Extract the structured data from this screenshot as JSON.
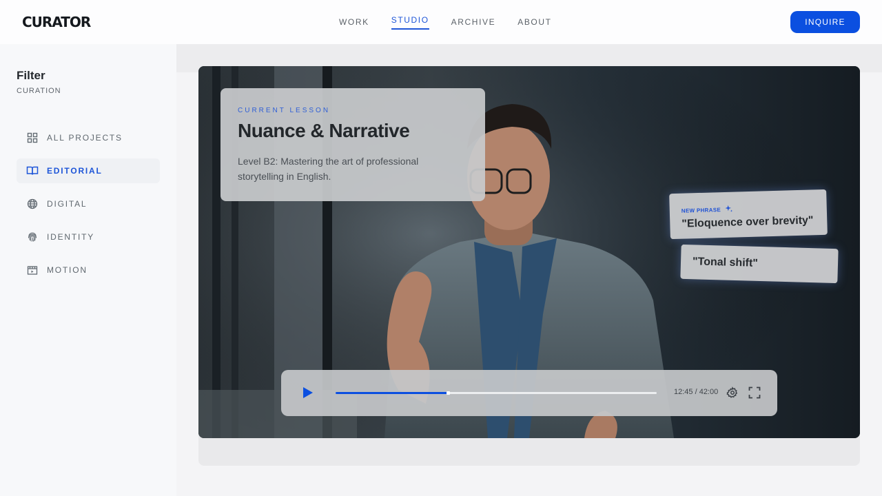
{
  "header": {
    "logo": "CURATOR",
    "nav": [
      "WORK",
      "STUDIO",
      "ARCHIVE",
      "ABOUT"
    ],
    "active_nav": "STUDIO",
    "cta": "INQUIRE"
  },
  "sidebar": {
    "title": "Filter",
    "subtitle": "CURATION",
    "items": [
      {
        "label": "ALL PROJECTS",
        "icon": "grid-icon"
      },
      {
        "label": "EDITORIAL",
        "icon": "book-icon"
      },
      {
        "label": "DIGITAL",
        "icon": "globe-icon"
      },
      {
        "label": "IDENTITY",
        "icon": "fingerprint-icon"
      },
      {
        "label": "MOTION",
        "icon": "film-icon"
      }
    ],
    "active_item": "EDITORIAL"
  },
  "lesson": {
    "kicker": "CURRENT LESSON",
    "title": "Nuance & Narrative",
    "description": "Level B2: Mastering the art of professional storytelling in English."
  },
  "phrases": {
    "kicker": "NEW PHRASE",
    "items": [
      "\"Eloquence over brevity\"",
      "\"Tonal shift\""
    ]
  },
  "player": {
    "time": "12:45 / 42:00",
    "progress": 0.35,
    "icons": [
      "play-icon",
      "settings-icon",
      "fullscreen-icon"
    ]
  },
  "colors": {
    "accent": "#0b4fe0",
    "active_text": "#1d55d8"
  }
}
